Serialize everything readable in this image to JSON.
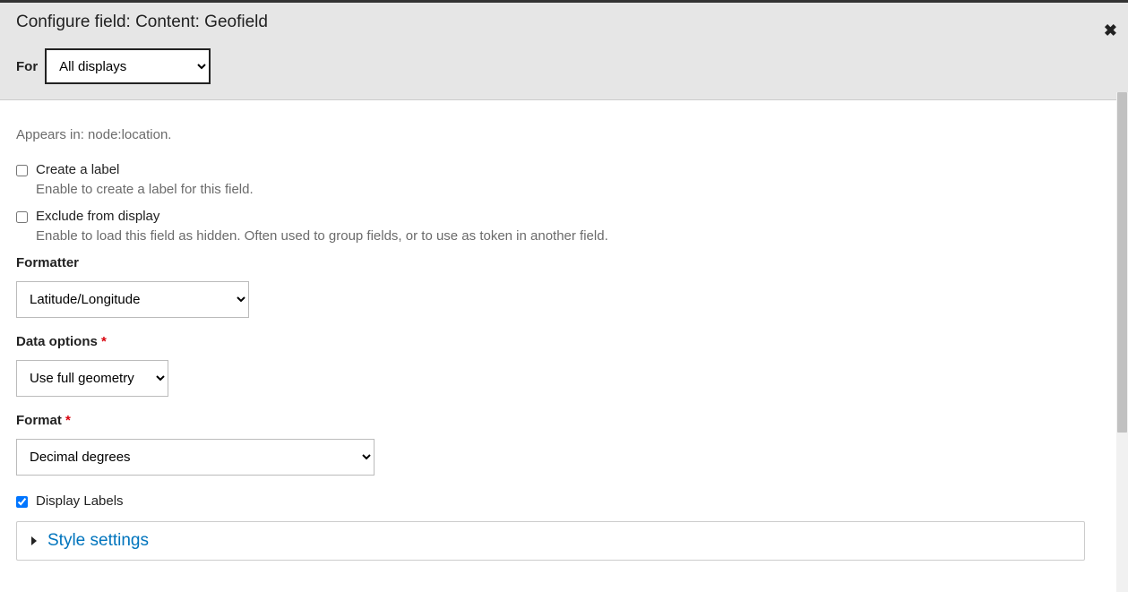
{
  "modal": {
    "title": "Configure field: Content: Geofield",
    "for_label": "For",
    "display_selector": {
      "selected": "All displays"
    }
  },
  "body": {
    "appears_in": "Appears in: node:location.",
    "create_label": {
      "label": "Create a label",
      "description": "Enable to create a label for this field.",
      "checked": false
    },
    "exclude_display": {
      "label": "Exclude from display",
      "description": "Enable to load this field as hidden. Often used to group fields, or to use as token in another field.",
      "checked": false
    },
    "formatter": {
      "label": "Formatter",
      "selected": "Latitude/Longitude"
    },
    "data_options": {
      "label": "Data options ",
      "selected": "Use full geometry"
    },
    "format": {
      "label": "Format ",
      "selected": "Decimal degrees"
    },
    "display_labels": {
      "label": "Display Labels",
      "checked": true
    },
    "style_settings": {
      "label": "Style settings"
    }
  }
}
